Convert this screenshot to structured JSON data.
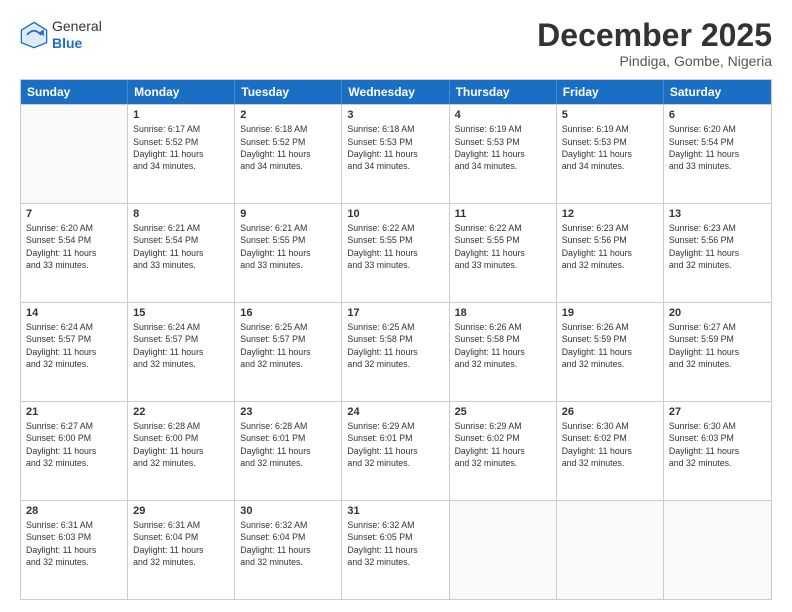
{
  "header": {
    "logo_line1": "General",
    "logo_line2": "Blue",
    "month": "December 2025",
    "location": "Pindiga, Gombe, Nigeria"
  },
  "days_of_week": [
    "Sunday",
    "Monday",
    "Tuesday",
    "Wednesday",
    "Thursday",
    "Friday",
    "Saturday"
  ],
  "weeks": [
    [
      {
        "day": "",
        "info": ""
      },
      {
        "day": "1",
        "info": "Sunrise: 6:17 AM\nSunset: 5:52 PM\nDaylight: 11 hours\nand 34 minutes."
      },
      {
        "day": "2",
        "info": "Sunrise: 6:18 AM\nSunset: 5:52 PM\nDaylight: 11 hours\nand 34 minutes."
      },
      {
        "day": "3",
        "info": "Sunrise: 6:18 AM\nSunset: 5:53 PM\nDaylight: 11 hours\nand 34 minutes."
      },
      {
        "day": "4",
        "info": "Sunrise: 6:19 AM\nSunset: 5:53 PM\nDaylight: 11 hours\nand 34 minutes."
      },
      {
        "day": "5",
        "info": "Sunrise: 6:19 AM\nSunset: 5:53 PM\nDaylight: 11 hours\nand 34 minutes."
      },
      {
        "day": "6",
        "info": "Sunrise: 6:20 AM\nSunset: 5:54 PM\nDaylight: 11 hours\nand 33 minutes."
      }
    ],
    [
      {
        "day": "7",
        "info": "Sunrise: 6:20 AM\nSunset: 5:54 PM\nDaylight: 11 hours\nand 33 minutes."
      },
      {
        "day": "8",
        "info": "Sunrise: 6:21 AM\nSunset: 5:54 PM\nDaylight: 11 hours\nand 33 minutes."
      },
      {
        "day": "9",
        "info": "Sunrise: 6:21 AM\nSunset: 5:55 PM\nDaylight: 11 hours\nand 33 minutes."
      },
      {
        "day": "10",
        "info": "Sunrise: 6:22 AM\nSunset: 5:55 PM\nDaylight: 11 hours\nand 33 minutes."
      },
      {
        "day": "11",
        "info": "Sunrise: 6:22 AM\nSunset: 5:55 PM\nDaylight: 11 hours\nand 33 minutes."
      },
      {
        "day": "12",
        "info": "Sunrise: 6:23 AM\nSunset: 5:56 PM\nDaylight: 11 hours\nand 32 minutes."
      },
      {
        "day": "13",
        "info": "Sunrise: 6:23 AM\nSunset: 5:56 PM\nDaylight: 11 hours\nand 32 minutes."
      }
    ],
    [
      {
        "day": "14",
        "info": "Sunrise: 6:24 AM\nSunset: 5:57 PM\nDaylight: 11 hours\nand 32 minutes."
      },
      {
        "day": "15",
        "info": "Sunrise: 6:24 AM\nSunset: 5:57 PM\nDaylight: 11 hours\nand 32 minutes."
      },
      {
        "day": "16",
        "info": "Sunrise: 6:25 AM\nSunset: 5:57 PM\nDaylight: 11 hours\nand 32 minutes."
      },
      {
        "day": "17",
        "info": "Sunrise: 6:25 AM\nSunset: 5:58 PM\nDaylight: 11 hours\nand 32 minutes."
      },
      {
        "day": "18",
        "info": "Sunrise: 6:26 AM\nSunset: 5:58 PM\nDaylight: 11 hours\nand 32 minutes."
      },
      {
        "day": "19",
        "info": "Sunrise: 6:26 AM\nSunset: 5:59 PM\nDaylight: 11 hours\nand 32 minutes."
      },
      {
        "day": "20",
        "info": "Sunrise: 6:27 AM\nSunset: 5:59 PM\nDaylight: 11 hours\nand 32 minutes."
      }
    ],
    [
      {
        "day": "21",
        "info": "Sunrise: 6:27 AM\nSunset: 6:00 PM\nDaylight: 11 hours\nand 32 minutes."
      },
      {
        "day": "22",
        "info": "Sunrise: 6:28 AM\nSunset: 6:00 PM\nDaylight: 11 hours\nand 32 minutes."
      },
      {
        "day": "23",
        "info": "Sunrise: 6:28 AM\nSunset: 6:01 PM\nDaylight: 11 hours\nand 32 minutes."
      },
      {
        "day": "24",
        "info": "Sunrise: 6:29 AM\nSunset: 6:01 PM\nDaylight: 11 hours\nand 32 minutes."
      },
      {
        "day": "25",
        "info": "Sunrise: 6:29 AM\nSunset: 6:02 PM\nDaylight: 11 hours\nand 32 minutes."
      },
      {
        "day": "26",
        "info": "Sunrise: 6:30 AM\nSunset: 6:02 PM\nDaylight: 11 hours\nand 32 minutes."
      },
      {
        "day": "27",
        "info": "Sunrise: 6:30 AM\nSunset: 6:03 PM\nDaylight: 11 hours\nand 32 minutes."
      }
    ],
    [
      {
        "day": "28",
        "info": "Sunrise: 6:31 AM\nSunset: 6:03 PM\nDaylight: 11 hours\nand 32 minutes."
      },
      {
        "day": "29",
        "info": "Sunrise: 6:31 AM\nSunset: 6:04 PM\nDaylight: 11 hours\nand 32 minutes."
      },
      {
        "day": "30",
        "info": "Sunrise: 6:32 AM\nSunset: 6:04 PM\nDaylight: 11 hours\nand 32 minutes."
      },
      {
        "day": "31",
        "info": "Sunrise: 6:32 AM\nSunset: 6:05 PM\nDaylight: 11 hours\nand 32 minutes."
      },
      {
        "day": "",
        "info": ""
      },
      {
        "day": "",
        "info": ""
      },
      {
        "day": "",
        "info": ""
      }
    ]
  ]
}
